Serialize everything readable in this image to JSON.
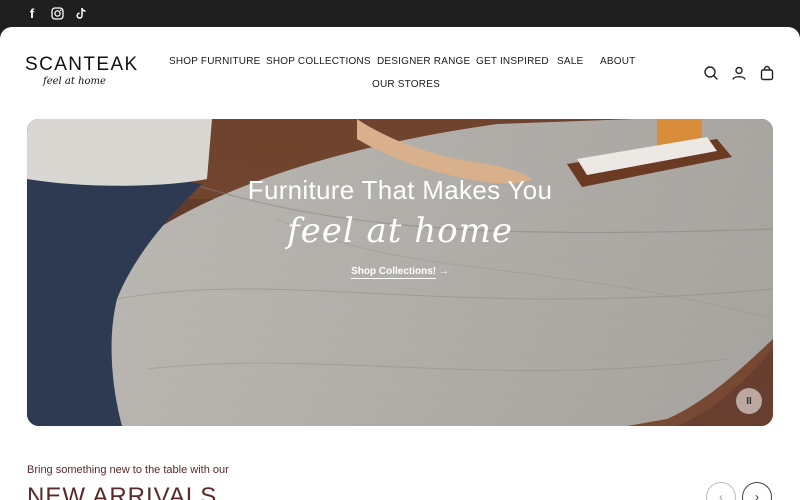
{
  "social": {
    "facebook": "f",
    "instagram": "instagram-icon",
    "tiktok": "tiktok-icon"
  },
  "brand": {
    "name": "SCANTEAK",
    "tagline": "feel at home"
  },
  "nav": {
    "items": [
      "SHOP FURNITURE",
      "SHOP COLLECTIONS",
      "DESIGNER RANGE",
      "GET INSPIRED",
      "SALE",
      "ABOUT",
      "OUR STORES"
    ]
  },
  "hero": {
    "title": "Furniture That Makes You",
    "script": "feel at home",
    "link_label": "Shop Collections!",
    "link_arrow": "→",
    "pause_label": "II"
  },
  "section": {
    "promo": "Bring something new to the table with our",
    "heading": "NEW ARRIVALS"
  },
  "carousel": {
    "prev": "‹",
    "next": "›"
  },
  "colors": {
    "topbar": "#1f1f1f",
    "accent": "#5a2a2a"
  }
}
